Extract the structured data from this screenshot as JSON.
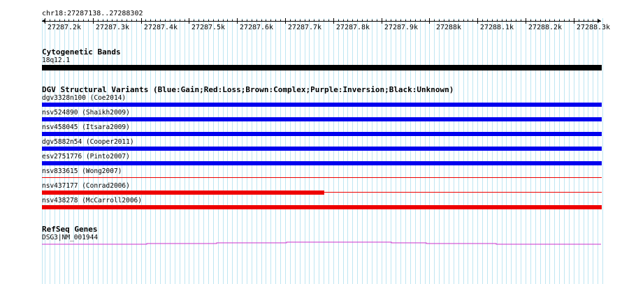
{
  "ruler": {
    "region": "chr18:27287138..27288302",
    "ticks": [
      "27287.2k",
      "27287.3k",
      "27287.4k",
      "27287.5k",
      "27287.6k",
      "27287.7k",
      "27287.8k",
      "27287.9k",
      "27288k",
      "27288.1k",
      "27288.2k",
      "27288.3k"
    ]
  },
  "cytoband": {
    "title": "Cytogenetic Bands",
    "band": "18q12.1",
    "color": "#000000"
  },
  "dgv": {
    "title": "DGV Structural Variants (Blue:Gain;Red:Loss;Brown:Complex;Purple:Inversion;Black:Unknown)",
    "variants": [
      {
        "label": "dgv3328n100 (Coe2014)",
        "type": "gain",
        "color": "#0000ee"
      },
      {
        "label": "nsv524890 (Shaikh2009)",
        "type": "gain",
        "color": "#0000ee"
      },
      {
        "label": "nsv458045 (Itsara2009)",
        "type": "gain",
        "color": "#0000ee"
      },
      {
        "label": "dgv5882n54 (Cooper2011)",
        "type": "gain",
        "color": "#0000ee"
      },
      {
        "label": "esv2751776 (Pinto2007)",
        "type": "gain",
        "color": "#0000ee"
      },
      {
        "label": "nsv833615 (Wong2007)",
        "type": "loss",
        "color": "#ee0000"
      },
      {
        "label": "nsv437177 (Conrad2006)",
        "type": "loss",
        "color": "#ee0000"
      },
      {
        "label": "nsv438278 (McCarroll2006)",
        "type": "loss",
        "color": "#ee0000"
      }
    ]
  },
  "refseq": {
    "title": "RefSeq Genes",
    "gene": "DSG3|NM_001944",
    "color": "#cc33cc"
  },
  "colors": {
    "grid": "#bfe6f2",
    "gain": "#0000ee",
    "loss": "#ee0000"
  }
}
